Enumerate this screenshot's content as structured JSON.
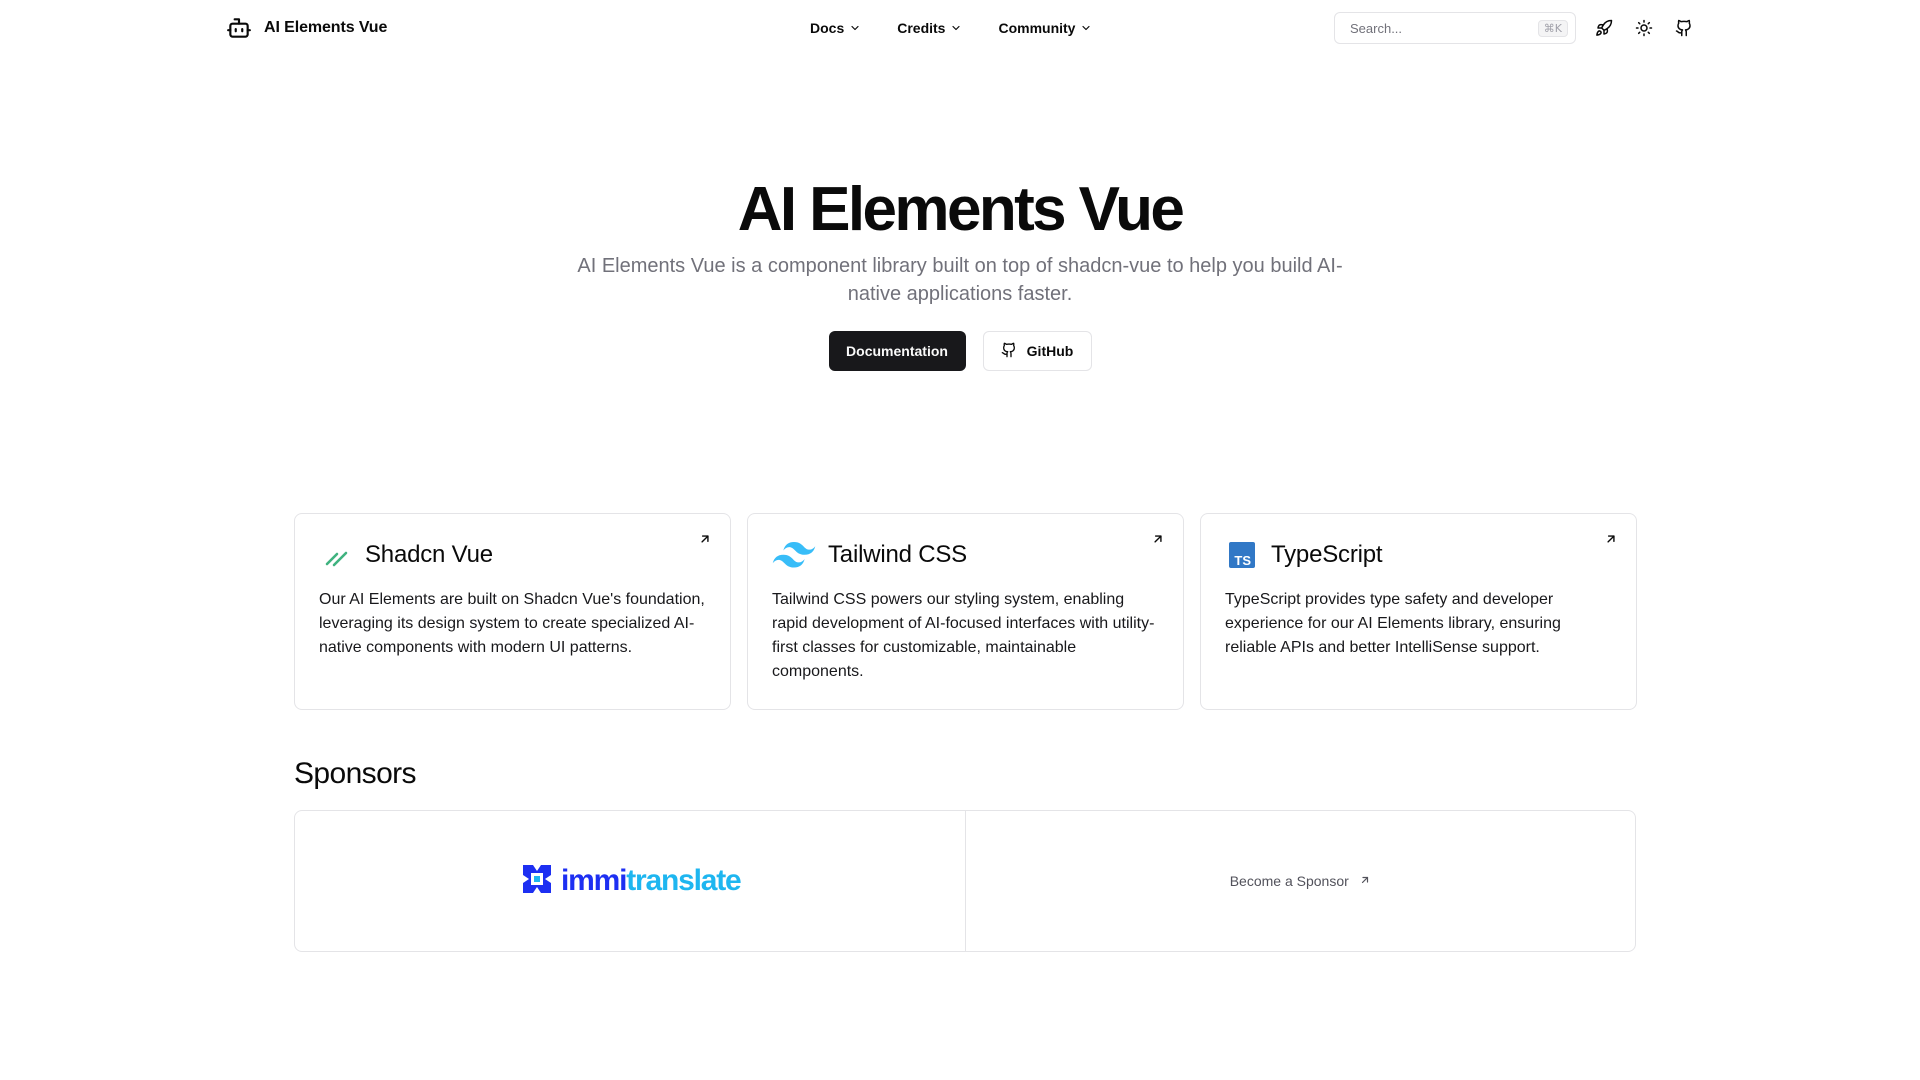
{
  "header": {
    "brand": "AI Elements Vue",
    "nav": [
      {
        "label": "Docs"
      },
      {
        "label": "Credits"
      },
      {
        "label": "Community"
      }
    ],
    "search": {
      "placeholder": "Search...",
      "shortcut": "⌘K"
    },
    "icons": [
      "sparkles-icon",
      "sun-icon",
      "github-icon"
    ]
  },
  "hero": {
    "title": "AI Elements Vue",
    "subtitle": "AI Elements Vue is a component library built on top of shadcn-vue to help you build AI-native applications faster.",
    "primary_button": "Documentation",
    "secondary_button": "GitHub"
  },
  "cards": [
    {
      "title": "Shadcn Vue",
      "icon": "shadcn-vue-icon",
      "description": "Our AI Elements are built on Shadcn Vue's foundation, leveraging its design system to create specialized AI-native components with modern UI patterns."
    },
    {
      "title": "Tailwind CSS",
      "icon": "tailwind-icon",
      "description": "Tailwind CSS powers our styling system, enabling rapid development of AI-focused interfaces with utility-first classes for customizable, maintainable components."
    },
    {
      "title": "TypeScript",
      "icon": "typescript-icon",
      "description": "TypeScript provides type safety and developer experience for our AI Elements library, ensuring reliable APIs and better IntelliSense support."
    }
  ],
  "sponsors": {
    "title": "Sponsors",
    "sponsor_logo_part1": "immi",
    "sponsor_logo_part2": "translate",
    "become_label": "Become a Sponsor"
  },
  "colors": {
    "primary": "#18181b",
    "border": "#e4e4e7",
    "muted_text": "#71717a",
    "shadcn_green": "#3fb27f",
    "tailwind_teal": "#38bdf8",
    "typescript_blue": "#3178c6",
    "immi_blue": "#1d2ff2",
    "immi_cyan": "#1eb6f0"
  }
}
